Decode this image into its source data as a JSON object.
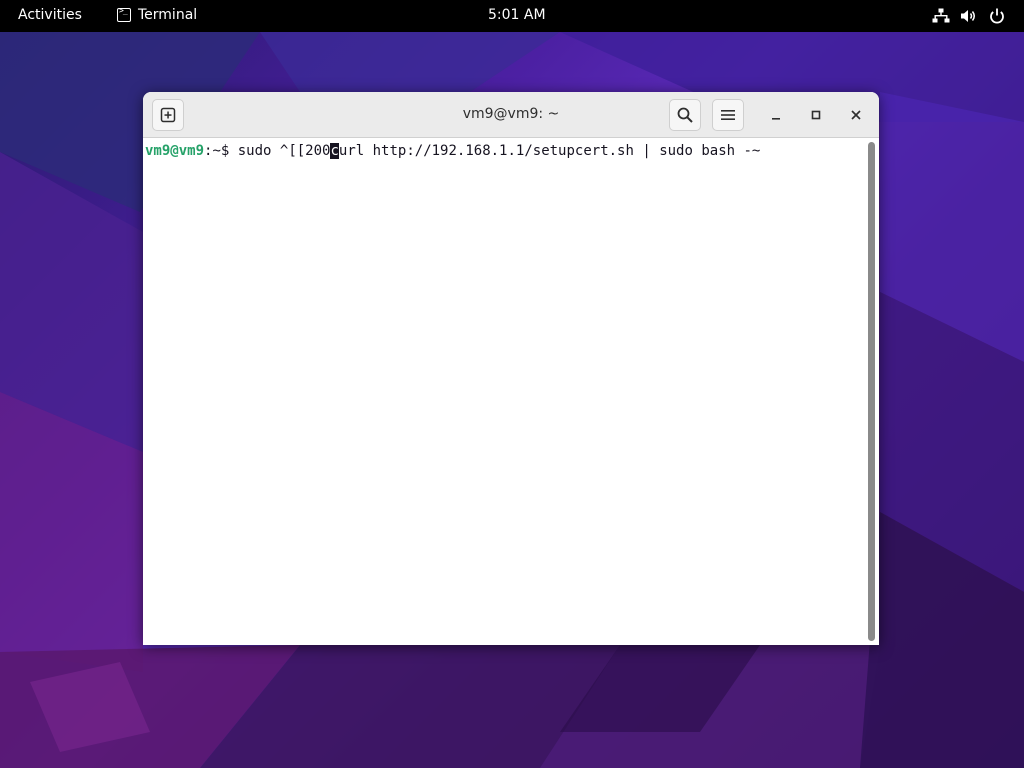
{
  "topbar": {
    "activities": "Activities",
    "app_name": "Terminal",
    "clock": "5:01 AM",
    "tray_icons": [
      "network-icon",
      "volume-icon",
      "power-icon"
    ]
  },
  "window": {
    "title": "vm9@vm9: ~",
    "new_tab_icon": "new-tab-icon",
    "search_icon": "search-icon",
    "menu_icon": "hamburger-menu-icon",
    "minimize_icon": "minimize-icon",
    "maximize_icon": "maximize-icon",
    "close_icon": "close-icon"
  },
  "terminal": {
    "prompt_user": "vm9@vm9",
    "prompt_sep": ":",
    "prompt_path": "~",
    "prompt_symbol": "$ ",
    "cmd_before_cursor": "sudo ^[[200",
    "cursor_char": "c",
    "cmd_after_cursor": "url http://192.168.1.1/setupcert.sh | sudo bash -~"
  },
  "colors": {
    "topbar_bg": "#000000",
    "prompt_user": "#26a269",
    "prompt_path": "#12488b",
    "terminal_bg": "#ffffff",
    "desktop_accent": "#5a2ab8"
  }
}
